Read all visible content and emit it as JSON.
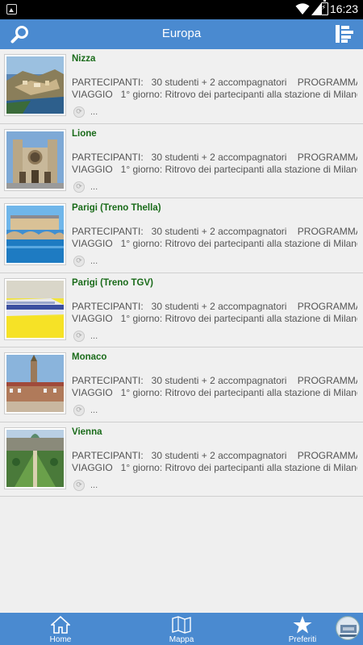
{
  "status": {
    "time": "16:23"
  },
  "appbar": {
    "title": "Europa",
    "search_icon": "search-icon",
    "menu_icon": "list-menu-icon"
  },
  "items": [
    {
      "name": "Nizza",
      "desc": "PARTECIPANTI:   30 studenti + 2 accompagnatori    PROGRAMMA\nVIAGGIO   1° giorno: Ritrovo dei partecipanti alla stazione di Milano...",
      "more": "..."
    },
    {
      "name": "Lione",
      "desc": "PARTECIPANTI:   30 studenti + 2 accompagnatori    PROGRAMMA\nVIAGGIO   1° giorno: Ritrovo dei partecipanti alla stazione di Milano...",
      "more": "..."
    },
    {
      "name": "Parigi (Treno Thella)",
      "desc": "PARTECIPANTI:   30 studenti + 2 accompagnatori    PROGRAMMA\nVIAGGIO   1° giorno: Ritrovo dei partecipanti alla stazione di Milano...",
      "more": "..."
    },
    {
      "name": "Parigi (Treno TGV)",
      "desc": "PARTECIPANTI:   30 studenti + 2 accompagnatori    PROGRAMMA\nVIAGGIO   1° giorno: Ritrovo dei partecipanti alla stazione di Milano...",
      "more": "..."
    },
    {
      "name": "Monaco",
      "desc": "PARTECIPANTI:   30 studenti + 2 accompagnatori    PROGRAMMA\nVIAGGIO   1° giorno: Ritrovo dei partecipanti alla stazione di Milano...",
      "more": "..."
    },
    {
      "name": "Vienna",
      "desc": "PARTECIPANTI:   30 studenti + 2 accompagnatori    PROGRAMMA\nVIAGGIO   1° giorno: Ritrovo dei partecipanti alla stazione di Milano...",
      "more": "..."
    }
  ],
  "tabs": {
    "home": "Home",
    "mappa": "Mappa",
    "preferiti": "Preferiti"
  },
  "colors": {
    "accent": "#4a8ad0",
    "title_green": "#1a6b1a"
  }
}
